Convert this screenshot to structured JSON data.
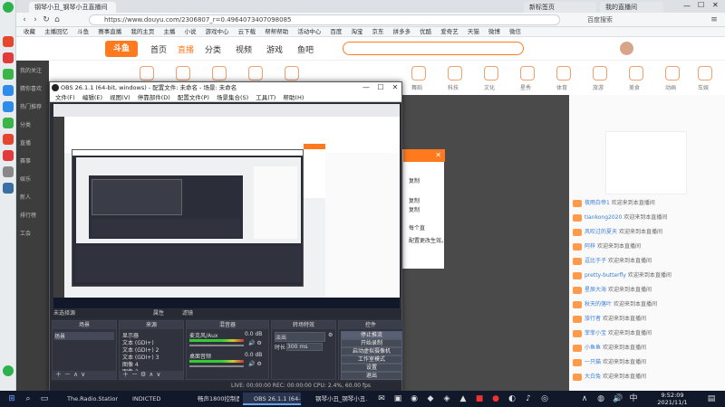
{
  "browser": {
    "tabs": [
      "钢琴小丑_钢琴小丑直播间",
      "新标签页",
      "我的直播间"
    ],
    "url": "https://www.douyu.com/2306807_r=0.4964073407098085",
    "right_status": "百度搜索",
    "bookmarks": [
      "收藏",
      "主播回忆",
      "斗鱼",
      "赛事直播",
      "我的主页",
      "主播",
      "小说",
      "游戏中心",
      "云下载",
      "帮帮帮助",
      "活动中心",
      "百度",
      "淘宝",
      "京东",
      "拼多多",
      "优酷",
      "爱奇艺",
      "天猫",
      "微博",
      "微信"
    ]
  },
  "douyu": {
    "logo": "斗鱼",
    "nav": [
      "首页",
      "直播",
      "分类",
      "视频",
      "游戏",
      "鱼吧"
    ],
    "sub_items": [
      "娱乐",
      "游戏",
      "手游",
      "户外",
      "音乐",
      "舞蹈",
      "科技",
      "文化",
      "星秀",
      "体育",
      "旅游",
      "美食",
      "动画",
      "车娱"
    ],
    "sidebar": [
      "我的关注",
      "猜你喜欢",
      "热门推荐",
      "分类",
      "直播",
      "赛事",
      "娱乐",
      "新人",
      "排行榜",
      "工会"
    ],
    "right_list": [
      {
        "name": "夜雨白帝1",
        "msg": "欢迎来到本直播间"
      },
      {
        "name": "tiankong2020",
        "msg": "欢迎来到本直播间"
      },
      {
        "name": "风吹过的夏天",
        "msg": "欢迎来到本直播间"
      },
      {
        "name": "阿梓",
        "msg": "欢迎来到本直播间"
      },
      {
        "name": "逗比于子",
        "msg": "欢迎来到本直播间"
      },
      {
        "name": "pretty-butterfly",
        "msg": "欢迎来到本直播间"
      },
      {
        "name": "星辰大海",
        "msg": "欢迎来到本直播间"
      },
      {
        "name": "秋天的落叶",
        "msg": "欢迎来到本直播间"
      },
      {
        "name": "旅行者",
        "msg": "欢迎来到本直播间"
      },
      {
        "name": "菲菲小宝",
        "msg": "欢迎来到本直播间"
      },
      {
        "name": "小鱼鱼",
        "msg": "欢迎来到本直播间"
      },
      {
        "name": "一只猫",
        "msg": "欢迎来到本直播间"
      },
      {
        "name": "大白兔",
        "msg": "欢迎来到本直播间"
      }
    ],
    "dialog_lines": [
      "复制",
      "复制",
      "复制",
      "每个直",
      "配置更改生效。"
    ]
  },
  "obs": {
    "title": "OBS 26.1.1 (64-bit, windows) - 配置文件: 未命名 - 场景: 未命名",
    "menu": [
      "文件(F)",
      "编辑(E)",
      "视图(V)",
      "停靠部件(D)",
      "配置文件(P)",
      "场景集合(S)",
      "工具(T)",
      "帮助(H)"
    ],
    "status_left": "未选择源",
    "status_btns": [
      "属性",
      "滤镜"
    ],
    "docks": {
      "scenes": {
        "title": "场景",
        "items": [
          "场景"
        ]
      },
      "sources": {
        "title": "来源",
        "items": [
          "显示器",
          "文本 (GDI+)",
          "文本 (GDI+) 2",
          "文本 (GDI+) 3",
          "图像 4",
          "图像 3"
        ]
      },
      "mixer": {
        "title": "混音器",
        "channels": [
          {
            "name": "麦克风/Aux",
            "db": "0.0 dB"
          },
          {
            "name": "桌面音频",
            "db": "0.0 dB"
          }
        ]
      },
      "transitions": {
        "title": "转场特效",
        "type": "淡出",
        "duration_label": "时长",
        "duration": "300 ms"
      },
      "controls": {
        "title": "控件",
        "buttons": [
          "停止推流",
          "开始录制",
          "启动虚拟摄像机",
          "工作室模式",
          "设置",
          "退出"
        ]
      }
    },
    "stream_status": "LIVE: 00:00:00   REC: 00:00:00   CPU: 2.4%, 60.00 fps"
  },
  "taskbar": {
    "items": [
      "The.Radio.Station",
      "INDICTED",
      "畅声1800控制面板",
      "OBS 26.1.1 (64-bi...",
      "钢琴小丑_钢琴小丑..."
    ],
    "time": "9:52:09",
    "date": "2021/11/1"
  }
}
